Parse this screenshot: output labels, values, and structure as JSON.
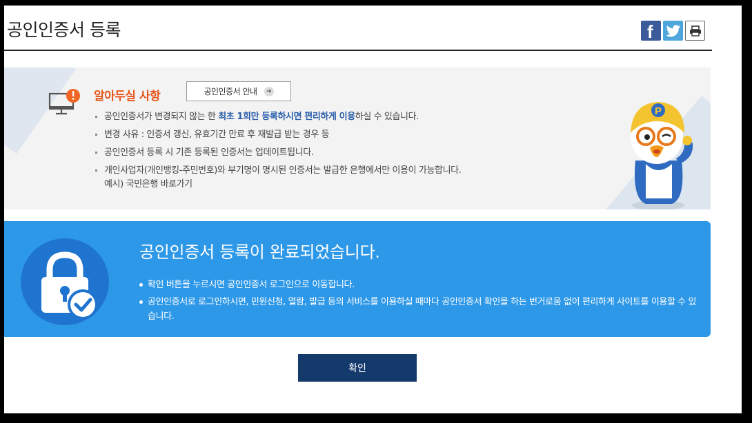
{
  "header": {
    "title": "공인인증서 등록",
    "share": {
      "facebook_icon": "facebook-icon",
      "twitter_icon": "twitter-icon",
      "print_icon": "print-icon"
    }
  },
  "notice": {
    "title": "알아두실 사항",
    "guide_button": "공인인증서 안내",
    "items": [
      {
        "pre": "공인인증서가 변경되지 않는 한 ",
        "highlight": "최초 1회만 등록하시면 편리하게 이용",
        "post": "하실 수 있습니다."
      },
      {
        "text": "변경 사유 : 인증서 갱신, 유효기간 만료 후 재발급 받는 경우 등"
      },
      {
        "text": "공인인증서 등록 시 기존 등록된 인증서는 업데이트됩니다."
      },
      {
        "text": "개인사업자(개인뱅킹-주민번호)와 부기명이 명시된 인증서는 발급한 은행에서만 이용이 가능합니다.",
        "example": "예시) 국민은행 바로가기"
      }
    ]
  },
  "complete": {
    "title": "공인인증서 등록이 완료되었습니다.",
    "items": [
      "확인 버튼을 누르시면 공인인증서 로그인으로 이동합니다.",
      "공인인증서로 로그인하시면, 민원신청, 열람, 발급 등의 서비스를 이용하실 때마다 공인인증서 확인을 하는 번거로움 없이 편리하게 사이트를 이용할 수 있습니다."
    ]
  },
  "confirm_button": "확인",
  "colors": {
    "accent_orange": "#e8541a",
    "highlight_blue": "#2a5ea9",
    "complete_bg": "#2e98e8",
    "lock_circle": "#1f74d0",
    "button_navy": "#133a6b"
  }
}
